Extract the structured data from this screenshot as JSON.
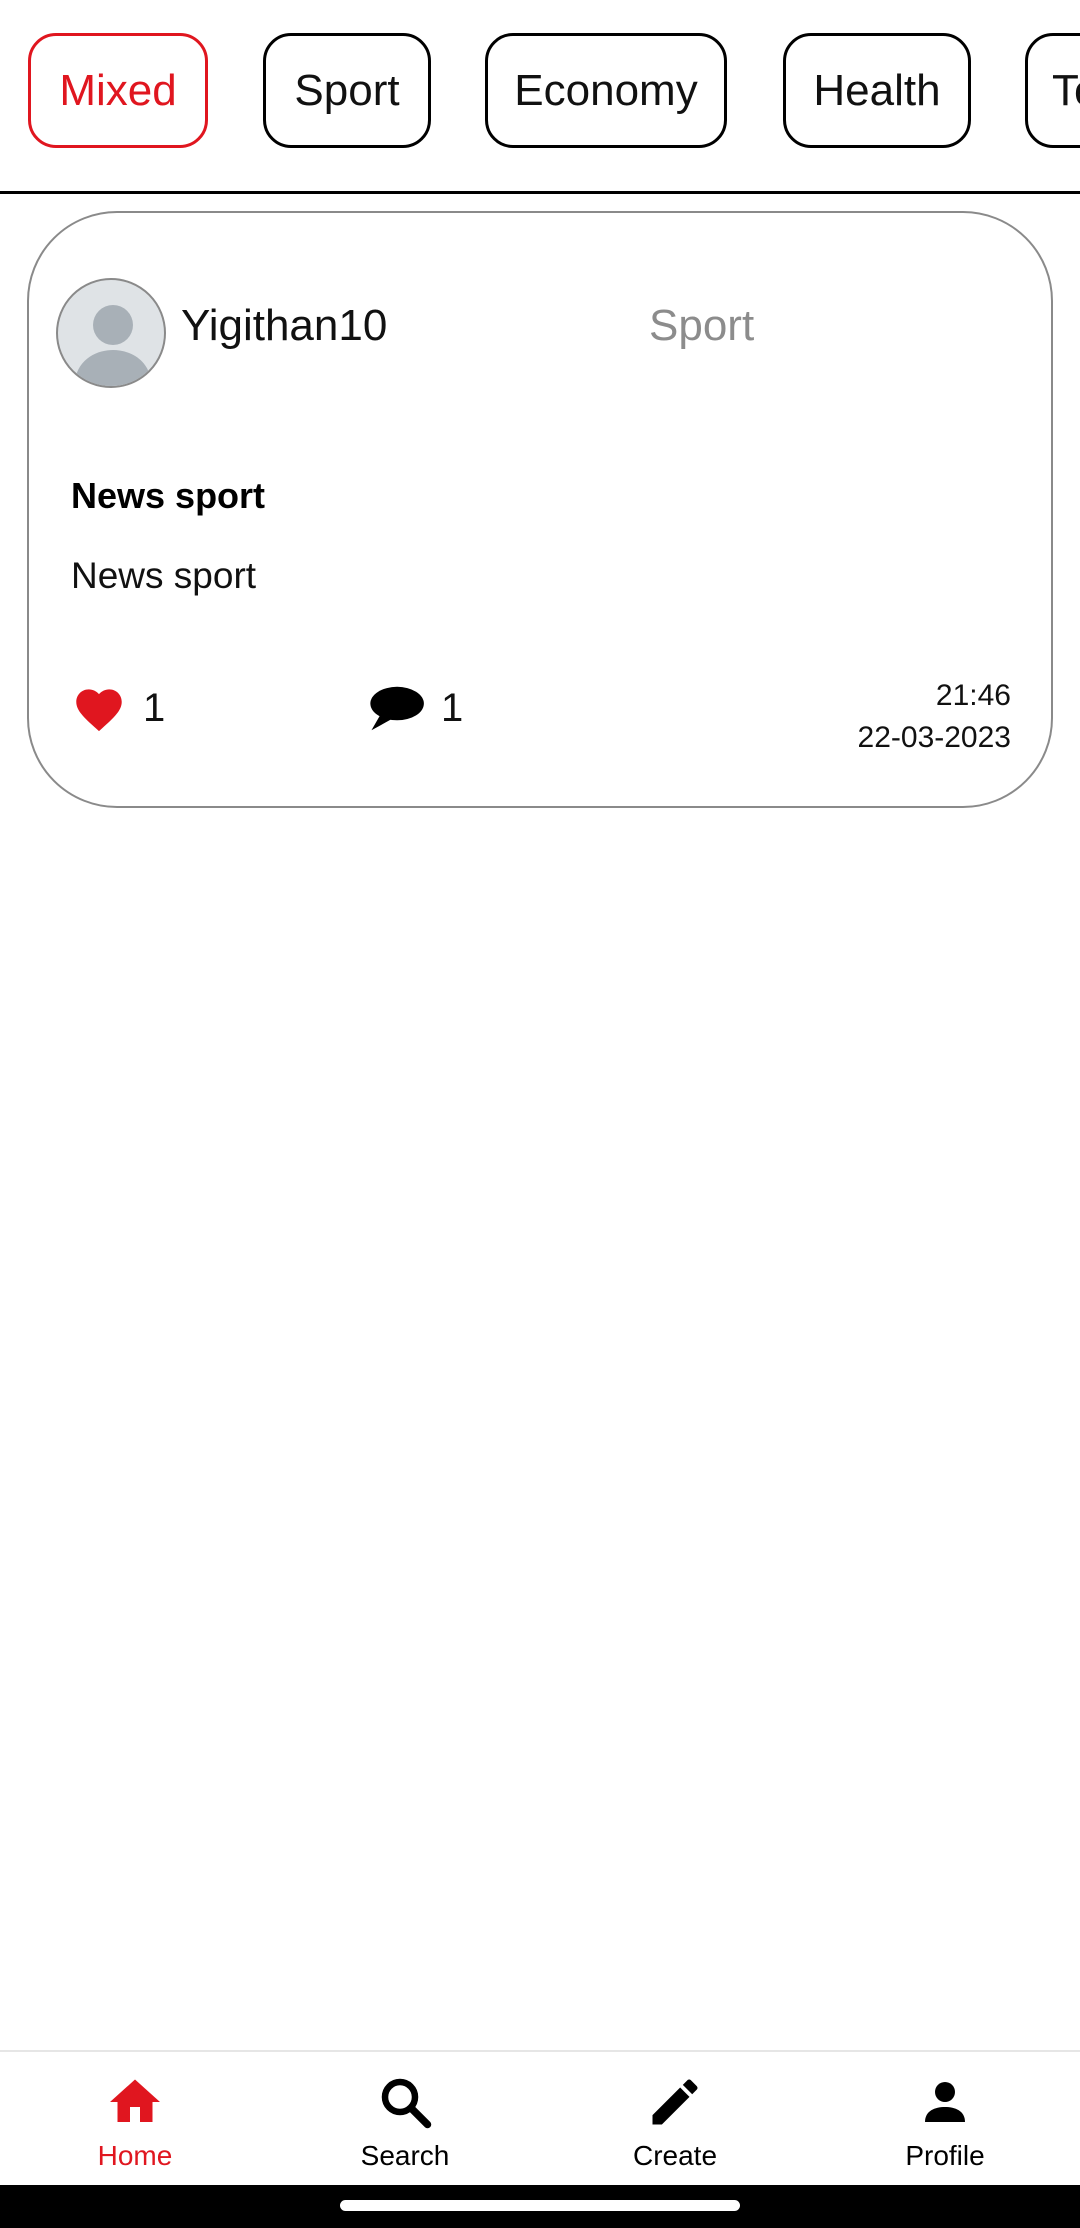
{
  "categories": [
    {
      "label": "Mixed",
      "active": true
    },
    {
      "label": "Sport",
      "active": false
    },
    {
      "label": "Economy",
      "active": false
    },
    {
      "label": "Health",
      "active": false
    },
    {
      "label": "Te",
      "active": false
    }
  ],
  "post": {
    "username": "Yigithan10",
    "category": "Sport",
    "title": "News sport",
    "body": "News sport",
    "likes": "1",
    "comments": "1",
    "time": "21:46",
    "date": "22-03-2023",
    "icons": {
      "like": "heart-icon",
      "comment": "speech-bubble-icon",
      "avatar": "default-user-avatar"
    }
  },
  "nav": {
    "items": [
      {
        "label": "Home",
        "icon": "home-icon",
        "active": true
      },
      {
        "label": "Search",
        "icon": "search-icon",
        "active": false
      },
      {
        "label": "Create",
        "icon": "pencil-icon",
        "active": false
      },
      {
        "label": "Profile",
        "icon": "person-icon",
        "active": false
      }
    ]
  },
  "colors": {
    "accent": "#e0161f",
    "muted": "#8c8c8c",
    "border": "#8a8a8a"
  }
}
